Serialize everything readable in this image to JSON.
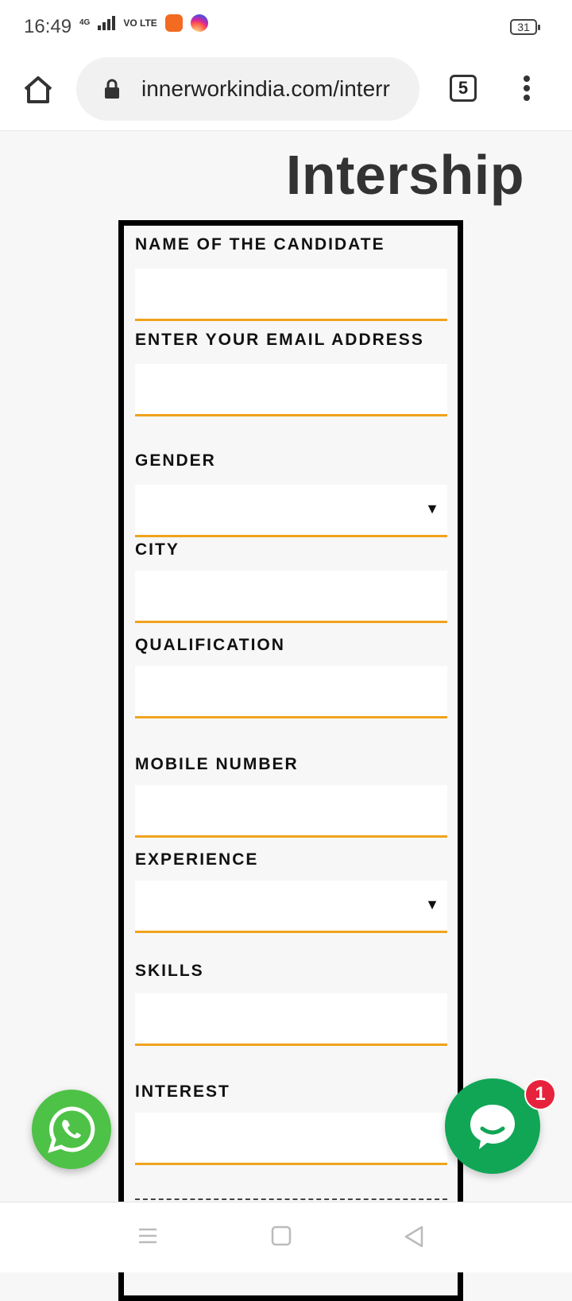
{
  "status_bar": {
    "time": "16:49",
    "network_label": "4G",
    "volte_label": "VO LTE",
    "battery": "31"
  },
  "browser": {
    "url": "innerworkindia.com/interr",
    "tab_count": "5"
  },
  "page": {
    "title": "Intership"
  },
  "form": {
    "fields": [
      {
        "label": "NAME OF THE CANDIDATE",
        "type": "text",
        "value": ""
      },
      {
        "label": "ENTER YOUR EMAIL ADDRESS",
        "type": "email",
        "value": ""
      },
      {
        "label": "GENDER",
        "type": "select",
        "value": ""
      },
      {
        "label": "CITY",
        "type": "text",
        "value": ""
      },
      {
        "label": "QUALIFICATION",
        "type": "text",
        "value": ""
      },
      {
        "label": "MOBILE NUMBER",
        "type": "tel",
        "value": ""
      },
      {
        "label": "EXPERIENCE",
        "type": "select",
        "value": ""
      },
      {
        "label": "SKILLS",
        "type": "text",
        "value": ""
      },
      {
        "label": "INTEREST",
        "type": "text",
        "value": ""
      }
    ],
    "select_arrow": "▼"
  },
  "floating": {
    "whatsapp_icon": "whatsapp-icon",
    "chat_icon": "chat-bubble-icon",
    "chat_badge": "1"
  },
  "colors": {
    "accent_underline": "#f0a31c",
    "whatsapp_green": "#4dc247",
    "chat_green": "#10a656",
    "badge_red": "#e6223c"
  }
}
